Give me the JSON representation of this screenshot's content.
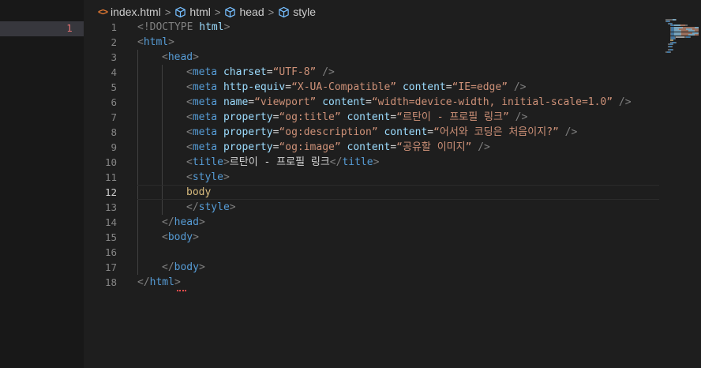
{
  "left_panel": {
    "active_line_number": "1"
  },
  "breadcrumb": {
    "file": "index.html",
    "file_icon": "html-icon",
    "items": [
      "html",
      "head",
      "style"
    ],
    "symbol_icon": "cube-icon",
    "separator": ">"
  },
  "editor": {
    "current_line": 12,
    "line_numbers": [
      "1",
      "2",
      "3",
      "4",
      "5",
      "6",
      "7",
      "8",
      "9",
      "10",
      "11",
      "12",
      "13",
      "14",
      "15",
      "16",
      "17",
      "18"
    ],
    "lines": [
      {
        "indent": 0,
        "tokens": [
          {
            "t": "<!DOCTYPE ",
            "c": "punct"
          },
          {
            "t": "html",
            "c": "attr"
          },
          {
            "t": ">",
            "c": "punct"
          }
        ]
      },
      {
        "indent": 0,
        "tokens": [
          {
            "t": "<",
            "c": "punct"
          },
          {
            "t": "html",
            "c": "tag"
          },
          {
            "t": ">",
            "c": "punct"
          }
        ]
      },
      {
        "indent": 1,
        "tokens": [
          {
            "t": "<",
            "c": "punct"
          },
          {
            "t": "head",
            "c": "tag"
          },
          {
            "t": ">",
            "c": "punct"
          }
        ]
      },
      {
        "indent": 2,
        "tokens": [
          {
            "t": "<",
            "c": "punct"
          },
          {
            "t": "meta",
            "c": "tag"
          },
          {
            "t": " charset",
            "c": "attr"
          },
          {
            "t": "=",
            "c": "text"
          },
          {
            "t": "“UTF-8”",
            "c": "str"
          },
          {
            "t": " />",
            "c": "punct"
          }
        ]
      },
      {
        "indent": 2,
        "tokens": [
          {
            "t": "<",
            "c": "punct"
          },
          {
            "t": "meta",
            "c": "tag"
          },
          {
            "t": " http-equiv",
            "c": "attr"
          },
          {
            "t": "=",
            "c": "text"
          },
          {
            "t": "“X-UA-Compatible”",
            "c": "str"
          },
          {
            "t": " content",
            "c": "attr"
          },
          {
            "t": "=",
            "c": "text"
          },
          {
            "t": "“IE=edge”",
            "c": "str"
          },
          {
            "t": " />",
            "c": "punct"
          }
        ]
      },
      {
        "indent": 2,
        "tokens": [
          {
            "t": "<",
            "c": "punct"
          },
          {
            "t": "meta",
            "c": "tag"
          },
          {
            "t": " name",
            "c": "attr"
          },
          {
            "t": "=",
            "c": "text"
          },
          {
            "t": "“viewport”",
            "c": "str"
          },
          {
            "t": " content",
            "c": "attr"
          },
          {
            "t": "=",
            "c": "text"
          },
          {
            "t": "“width=device-width, initial-scale=1.0”",
            "c": "str"
          },
          {
            "t": " />",
            "c": "punct"
          }
        ]
      },
      {
        "indent": 2,
        "tokens": [
          {
            "t": "<",
            "c": "punct"
          },
          {
            "t": "meta",
            "c": "tag"
          },
          {
            "t": " property",
            "c": "attr"
          },
          {
            "t": "=",
            "c": "text"
          },
          {
            "t": "“og:title”",
            "c": "str"
          },
          {
            "t": " content",
            "c": "attr"
          },
          {
            "t": "=",
            "c": "text"
          },
          {
            "t": "“르탄이 - 프로필 링크”",
            "c": "str"
          },
          {
            "t": " />",
            "c": "punct"
          }
        ]
      },
      {
        "indent": 2,
        "tokens": [
          {
            "t": "<",
            "c": "punct"
          },
          {
            "t": "meta",
            "c": "tag"
          },
          {
            "t": " property",
            "c": "attr"
          },
          {
            "t": "=",
            "c": "text"
          },
          {
            "t": "“og:description”",
            "c": "str"
          },
          {
            "t": " content",
            "c": "attr"
          },
          {
            "t": "=",
            "c": "text"
          },
          {
            "t": "“어서와 코딩은 처음이지?”",
            "c": "str"
          },
          {
            "t": " />",
            "c": "punct"
          }
        ]
      },
      {
        "indent": 2,
        "tokens": [
          {
            "t": "<",
            "c": "punct"
          },
          {
            "t": "meta",
            "c": "tag"
          },
          {
            "t": " property",
            "c": "attr"
          },
          {
            "t": "=",
            "c": "text"
          },
          {
            "t": "“og:image”",
            "c": "str"
          },
          {
            "t": " content",
            "c": "attr"
          },
          {
            "t": "=",
            "c": "text"
          },
          {
            "t": "“공유할 이미지”",
            "c": "str"
          },
          {
            "t": " />",
            "c": "punct"
          }
        ]
      },
      {
        "indent": 2,
        "tokens": [
          {
            "t": "<",
            "c": "punct"
          },
          {
            "t": "title",
            "c": "tag"
          },
          {
            "t": ">",
            "c": "punct"
          },
          {
            "t": "르탄이 - 프로필 링크",
            "c": "text"
          },
          {
            "t": "</",
            "c": "punct"
          },
          {
            "t": "title",
            "c": "tag"
          },
          {
            "t": ">",
            "c": "punct"
          }
        ]
      },
      {
        "indent": 2,
        "tokens": [
          {
            "t": "<",
            "c": "punct"
          },
          {
            "t": "style",
            "c": "tag"
          },
          {
            "t": ">",
            "c": "punct"
          }
        ]
      },
      {
        "indent": 2,
        "tokens": [
          {
            "t": "body",
            "c": "css"
          }
        ]
      },
      {
        "indent": 2,
        "tokens": [
          {
            "t": "</",
            "c": "punct"
          },
          {
            "t": "style",
            "c": "tag"
          },
          {
            "t": ">",
            "c": "punct"
          }
        ]
      },
      {
        "indent": 1,
        "tokens": [
          {
            "t": "</",
            "c": "punct"
          },
          {
            "t": "head",
            "c": "tag"
          },
          {
            "t": ">",
            "c": "punct"
          }
        ]
      },
      {
        "indent": 1,
        "tokens": [
          {
            "t": "<",
            "c": "punct"
          },
          {
            "t": "body",
            "c": "tag"
          },
          {
            "t": ">",
            "c": "punct"
          }
        ]
      },
      {
        "indent": 1,
        "tokens": []
      },
      {
        "indent": 1,
        "tokens": [
          {
            "t": "</",
            "c": "punct"
          },
          {
            "t": "body",
            "c": "tag"
          },
          {
            "t": ">",
            "c": "punct"
          }
        ]
      },
      {
        "indent": 0,
        "tokens": [
          {
            "t": "</",
            "c": "punct"
          },
          {
            "t": "html",
            "c": "tag"
          },
          {
            "t": ">",
            "c": "punct"
          }
        ]
      }
    ]
  },
  "colors": {
    "background": "#1e1e1e",
    "side_panel": "#181818",
    "tag": "#569cd6",
    "attribute": "#9cdcfe",
    "string": "#ce9178",
    "selector": "#d7ba7d",
    "punctuation": "#808080",
    "error": "#f14c4c"
  }
}
